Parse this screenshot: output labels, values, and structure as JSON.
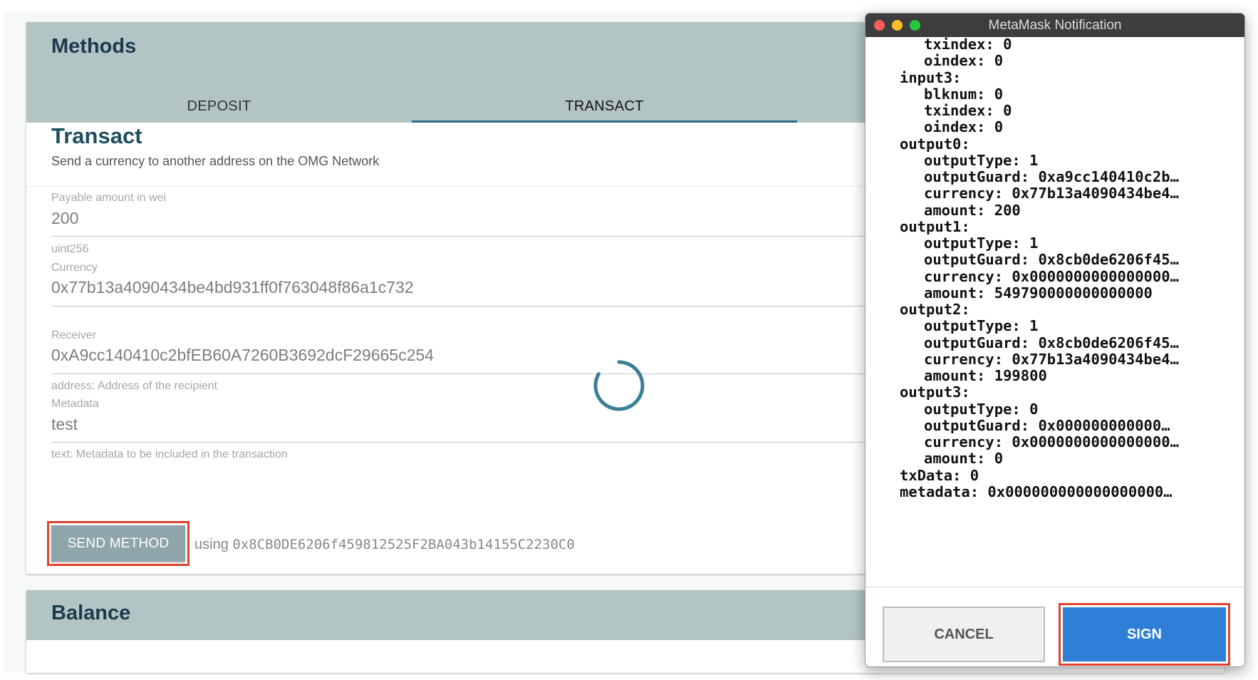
{
  "methods": {
    "title": "Methods",
    "tabs": [
      {
        "label": "DEPOSIT",
        "active": false
      },
      {
        "label": "TRANSACT",
        "active": true
      }
    ]
  },
  "transact": {
    "title": "Transact",
    "subtitle": "Send a currency to another address on the OMG Network",
    "fields": {
      "amount": {
        "label": "Payable amount in wei",
        "value": "200"
      },
      "currency": {
        "type_label": "uint256",
        "label": "Currency",
        "value": "0x77b13a4090434be4bd931ff0f763048f86a1c732"
      },
      "receiver": {
        "label": "Receiver",
        "value": "0xA9cc140410c2bfEB60A7260B3692dcF29665c254",
        "helper": "address: Address of the recipient"
      },
      "metadata": {
        "label": "Metadata",
        "value": "test",
        "helper": "text: Metadata to be included in the transaction"
      }
    },
    "send_button": "SEND METHOD",
    "using_label": "using",
    "using_address": "0x8CB0DE6206f459812525F2BA043b14155C2230C0"
  },
  "balance": {
    "title": "Balance"
  },
  "metamask": {
    "window_title": "MetaMask Notification",
    "lines": [
      {
        "indent": 2,
        "text": "txindex: 0"
      },
      {
        "indent": 2,
        "text": "oindex: 0"
      },
      {
        "indent": 1,
        "text": "input3:"
      },
      {
        "indent": 2,
        "text": "blknum: 0"
      },
      {
        "indent": 2,
        "text": "txindex: 0"
      },
      {
        "indent": 2,
        "text": "oindex: 0"
      },
      {
        "indent": 1,
        "text": "output0:"
      },
      {
        "indent": 2,
        "text": "outputType: 1"
      },
      {
        "indent": 2,
        "text": "outputGuard: 0xa9cc140410c2b…"
      },
      {
        "indent": 2,
        "text": "currency: 0x77b13a4090434be4…"
      },
      {
        "indent": 2,
        "text": "amount: 200"
      },
      {
        "indent": 1,
        "text": "output1:"
      },
      {
        "indent": 2,
        "text": "outputType: 1"
      },
      {
        "indent": 2,
        "text": "outputGuard: 0x8cb0de6206f45…"
      },
      {
        "indent": 2,
        "text": "currency: 0x0000000000000000…"
      },
      {
        "indent": 2,
        "text": "amount: 549790000000000000"
      },
      {
        "indent": 1,
        "text": "output2:"
      },
      {
        "indent": 2,
        "text": "outputType: 1"
      },
      {
        "indent": 2,
        "text": "outputGuard: 0x8cb0de6206f45…"
      },
      {
        "indent": 2,
        "text": "currency: 0x77b13a4090434be4…"
      },
      {
        "indent": 2,
        "text": "amount: 199800"
      },
      {
        "indent": 1,
        "text": "output3:"
      },
      {
        "indent": 2,
        "text": "outputType: 0"
      },
      {
        "indent": 2,
        "text": "outputGuard: 0x000000000000…"
      },
      {
        "indent": 2,
        "text": "currency: 0x0000000000000000…"
      },
      {
        "indent": 2,
        "text": "amount: 0"
      },
      {
        "indent": 1,
        "text": "txData: 0"
      },
      {
        "indent": 1,
        "text": "metadata: 0x000000000000000000…"
      }
    ],
    "cancel_label": "CANCEL",
    "sign_label": "SIGN"
  },
  "colors": {
    "header_bg": "#b3c4c4",
    "title_text": "#1c3a4e",
    "tab_indicator": "#2b6d87",
    "send_button_bg": "#8fa5ac",
    "sign_button_bg": "#2f7fd6",
    "highlight_outline": "#e0432e",
    "spinner": "#3a7f94"
  },
  "icons": {
    "loading": "spinner-icon",
    "window_controls": [
      "close-dot-icon",
      "minimize-dot-icon",
      "maximize-dot-icon"
    ]
  }
}
